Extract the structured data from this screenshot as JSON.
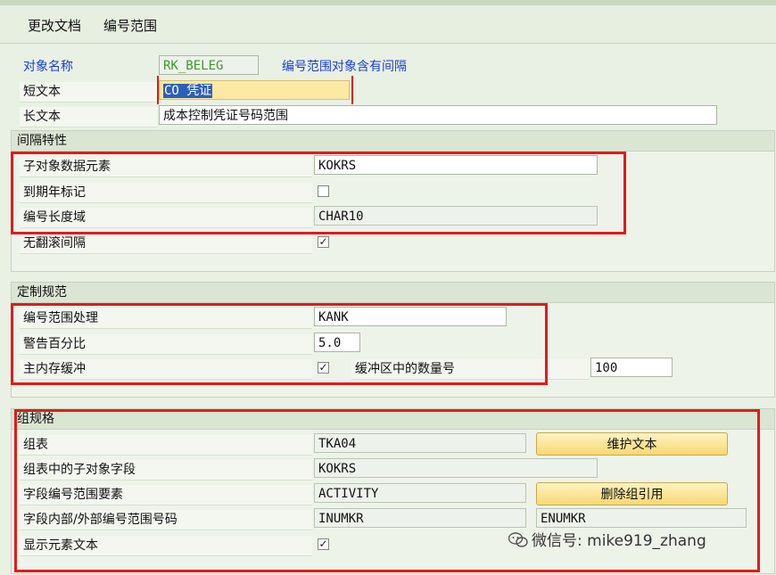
{
  "toolbar": {
    "change_doc": "更改文档",
    "number_range": "编号范围"
  },
  "header": {
    "object_name_label": "对象名称",
    "object_name_value": "RK_BELEG",
    "object_note": "编号范围对象含有间隔",
    "short_text_label": "短文本",
    "short_text_value": "CO 凭证",
    "long_text_label": "长文本",
    "long_text_value": "成本控制凭证号码范围"
  },
  "interval": {
    "title": "间隔特性",
    "sub_object_label": "子对象数据元素",
    "sub_object_value": "KOKRS",
    "year_flag_label": "到期年标记",
    "year_flag_checked": false,
    "length_domain_label": "编号长度域",
    "length_domain_value": "CHAR10",
    "no_rollover_label": "无翻滚间隔",
    "no_rollover_checked": true
  },
  "custom": {
    "title": "定制规范",
    "processing_label": "编号范围处理",
    "processing_value": "KANK",
    "warning_label": "警告百分比",
    "warning_value": "5.0",
    "buffer_label": "主内存缓冲",
    "buffer_checked": true,
    "buffer_count_label": "缓冲区中的数量号",
    "buffer_count_value": "100"
  },
  "group": {
    "title": "组规格",
    "table_label": "组表",
    "table_value": "TKA04",
    "maintain_text_button": "维护文本",
    "subobj_field_label": "组表中的子对象字段",
    "subobj_field_value": "KOKRS",
    "element_label": "字段编号范围要素",
    "element_value": "ACTIVITY",
    "delete_ref_button": "删除组引用",
    "int_ext_label": "字段内部/外部编号范围号码",
    "int_value": "INUMKR",
    "ext_value": "ENUMKR",
    "show_text_label": "显示元素文本",
    "show_text_checked": true
  },
  "watermark": {
    "text": "微信号: mike919_zhang"
  },
  "colors": {
    "highlight_red": "#e31a1a",
    "button_yellow": "#f7d873",
    "field_yellow": "#fde9a4",
    "label_blue": "#1a3fd0",
    "value_green": "#3b9a2b"
  }
}
